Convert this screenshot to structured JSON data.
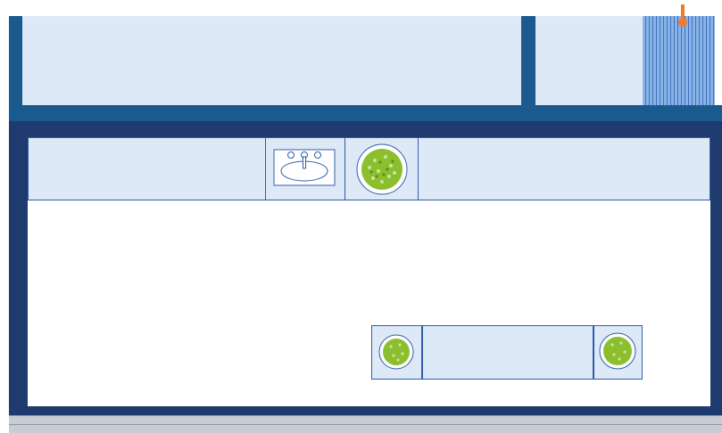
{
  "plan": {
    "wall_color": "#1f3a6e",
    "wall_accent_color": "#1a5a8f",
    "room_fill_color": "#dde9f6",
    "outline_color": "#2f5ea8",
    "radiator_color": "#89b4e6",
    "marker_color": "#f07a2e",
    "floor_color": "#c7cdd3",
    "plant_color": "#8cbf2e",
    "fixtures": {
      "sink_icon": "sink-icon",
      "plant_icon": "plant-icon",
      "radiator_icon": "radiator-icon",
      "marker_icon": "marker-icon"
    }
  }
}
